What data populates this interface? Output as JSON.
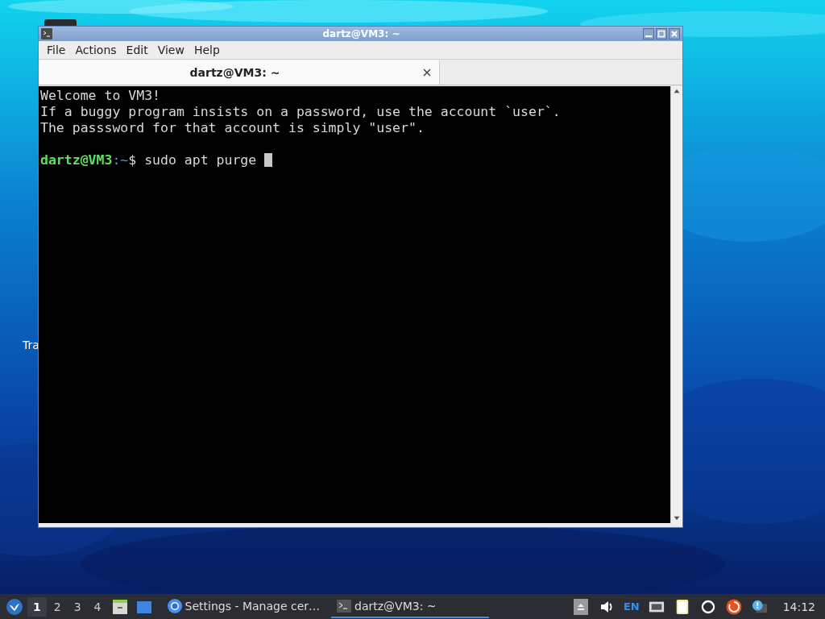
{
  "desktop": {
    "icons": [
      {
        "label": "Tra"
      }
    ]
  },
  "window": {
    "title": "dartz@VM3: ~",
    "active": true
  },
  "menu": [
    "File",
    "Actions",
    "Edit",
    "View",
    "Help"
  ],
  "tabs": [
    {
      "label": "dartz@VM3: ~",
      "selected": true
    }
  ],
  "terminal": {
    "lines": [
      {
        "kind": "text",
        "text": "Welcome to VM3!"
      },
      {
        "kind": "text",
        "text": "If a buggy program insists on a password, use the account `user`."
      },
      {
        "kind": "text",
        "text": "The passsword for that account is simply \"user\"."
      },
      {
        "kind": "blank"
      },
      {
        "kind": "prompt",
        "user": "dartz@VM3",
        "separator": ":",
        "path": "~",
        "symbol": "$",
        "command": "sudo apt purge ",
        "cursor": true
      }
    ]
  },
  "taskbar": {
    "workspaces": [
      {
        "label": "1",
        "selected": true
      },
      {
        "label": "2",
        "selected": false
      },
      {
        "label": "3",
        "selected": false
      },
      {
        "label": "4",
        "selected": false
      }
    ],
    "tasks": [
      {
        "kind": "browser",
        "label": "Settings - Manage cer…",
        "selected": false
      },
      {
        "kind": "terminal",
        "label": "dartz@VM3: ~",
        "selected": true
      }
    ],
    "language": "EN",
    "clock": "14:12"
  }
}
